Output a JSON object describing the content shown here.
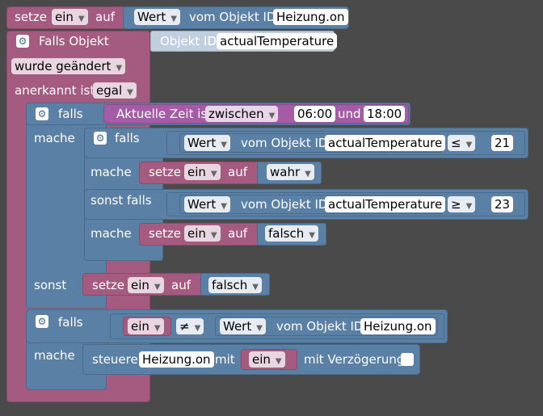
{
  "blocks": {
    "top": {
      "setze": "setze",
      "ein": "ein",
      "auf": "auf",
      "wert": "Wert",
      "vom_objekt": "vom Objekt ID",
      "obj": "Heizung.on"
    },
    "trigger": {
      "title": "Falls Objekt",
      "objekt_id": "Objekt ID",
      "obj": "actualTemperature",
      "changed": "wurde geändert",
      "anerkannt": "anerkannt ist",
      "egal": "egal"
    },
    "if_time": {
      "falls": "falls",
      "mache": "mache",
      "sonst": "sonst",
      "aktuelle": "Aktuelle Zeit ist",
      "zwischen": "zwischen",
      "t1": "06:00",
      "und": "und",
      "t2": "18:00"
    },
    "inner_if": {
      "falls": "falls",
      "mache": "mache",
      "sonst_falls": "sonst falls",
      "mache2": "mache",
      "wert": "Wert",
      "vom_objekt": "vom Objekt ID",
      "obj": "actualTemperature",
      "le": "≤",
      "v1": "21",
      "ge": "≥",
      "v2": "23",
      "setze": "setze",
      "ein": "ein",
      "auf": "auf",
      "wahr": "wahr",
      "falsch": "falsch"
    },
    "else_set": {
      "setze": "setze",
      "ein": "ein",
      "auf": "auf",
      "falsch": "falsch"
    },
    "if_change": {
      "falls": "falls",
      "mache": "mache",
      "ein": "ein",
      "neq": "≠",
      "wert": "Wert",
      "vom_objekt": "vom Objekt ID",
      "obj": "Heizung.on",
      "steuere": "steuere",
      "steuere_obj": "Heizung.on",
      "mit": "mit",
      "ein2": "ein",
      "delay": "mit Verzögerung"
    }
  },
  "icons": {
    "gear": "gear-icon",
    "dropdown": "chevron-down-icon"
  },
  "colors": {
    "background": "#4a4a4a",
    "variables": "#a55b80",
    "logic": "#5b80a5",
    "time": "#a55ba5"
  }
}
